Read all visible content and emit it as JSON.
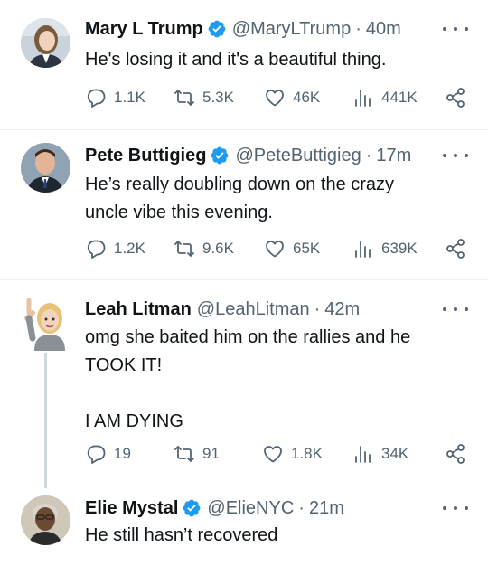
{
  "tweets": [
    {
      "name": "Mary L Trump",
      "handle": "@MaryLTrump",
      "separator": "·",
      "time": "40m",
      "text": "He's losing it and it's a beautiful thing.",
      "replies": "1.1K",
      "retweets": "5.3K",
      "likes": "46K",
      "views": "441K"
    },
    {
      "name": "Pete Buttigieg",
      "handle": "@PeteButtigieg",
      "separator": "·",
      "time": "17m",
      "text": "He’s really doubling down on the crazy\nuncle vibe this evening.",
      "replies": "1.2K",
      "retweets": "9.6K",
      "likes": "65K",
      "views": "639K"
    },
    {
      "name": "Leah Litman",
      "handle": "@LeahLitman",
      "separator": "·",
      "time": "42m",
      "text": "omg she baited him on the rallies and he\nTOOK IT!\n\nI AM DYING",
      "replies": "19",
      "retweets": "91",
      "likes": "1.8K",
      "views": "34K"
    },
    {
      "name": "Elie Mystal",
      "handle": "@ElieNYC",
      "separator": "·",
      "time": "21m",
      "text": "He still hasn’t recovered"
    }
  ],
  "colors": {
    "verified_badge": "#1d9bf0",
    "secondary_text": "#536471",
    "primary_text": "#0f1419",
    "thread_line": "#cfd9de"
  },
  "icons": [
    "verified-badge-icon",
    "more-options-icon",
    "reply-icon",
    "retweet-icon",
    "like-icon",
    "views-icon",
    "share-icon"
  ]
}
